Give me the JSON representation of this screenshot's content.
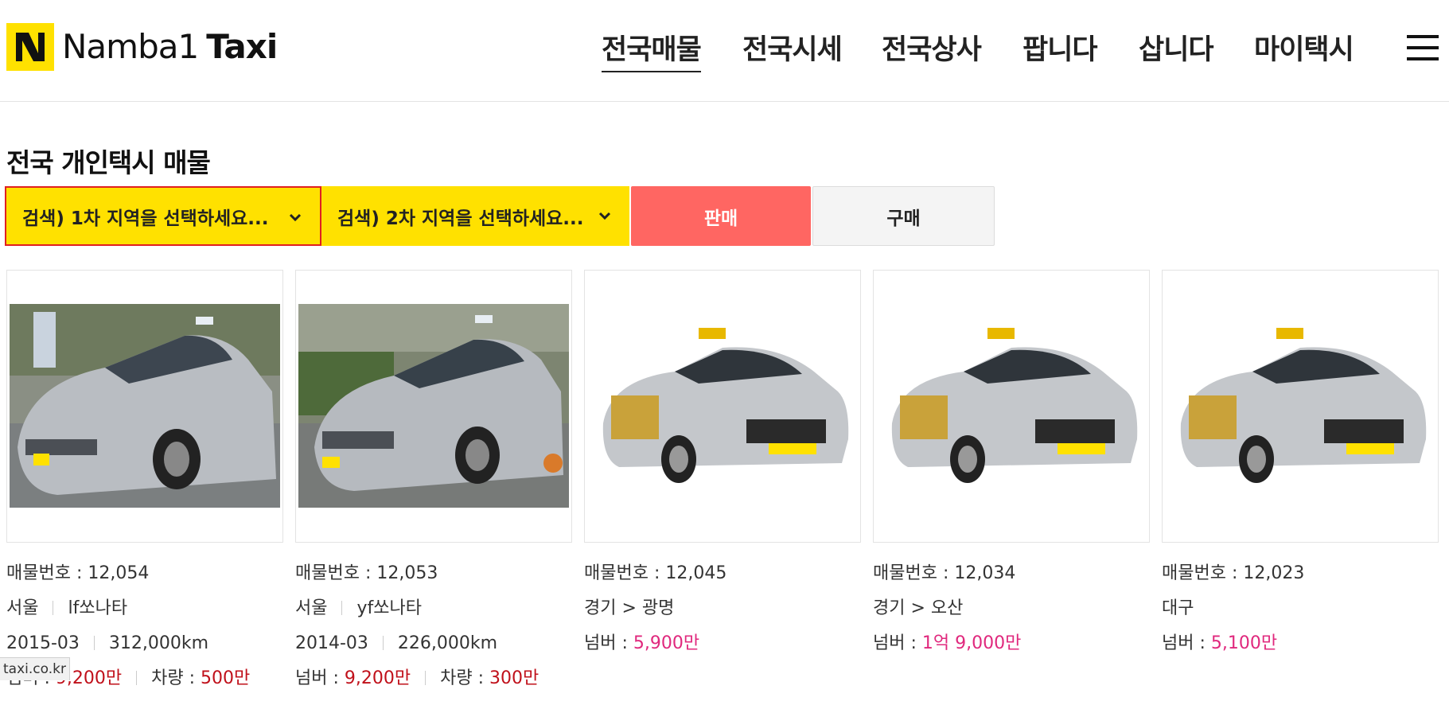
{
  "header": {
    "logo_text_regular": "Namba1",
    "logo_text_bold": "Taxi",
    "nav": [
      {
        "label": "전국매물",
        "active": true
      },
      {
        "label": "전국시세",
        "active": false
      },
      {
        "label": "전국상사",
        "active": false
      },
      {
        "label": "팝니다",
        "active": false
      },
      {
        "label": "삽니다",
        "active": false
      },
      {
        "label": "마이택시",
        "active": false
      }
    ]
  },
  "page": {
    "title": "전국 개인택시 매물"
  },
  "filters": {
    "region1": "검색) 1차 지역을 선택하세요...",
    "region2": "검색) 2차 지역을 선택하세요...",
    "sell_label": "판매",
    "buy_label": "구매"
  },
  "listings": [
    {
      "number": "매물번호 : 12,054",
      "region": "서울",
      "model": "lf쏘나타",
      "year": "2015-03",
      "mileage": "312,000km",
      "plate_label": "넘버 : ",
      "plate_price": "9,200만",
      "car_label": "차량 : ",
      "car_price": "500만"
    },
    {
      "number": "매물번호 : 12,053",
      "region": "서울",
      "model": "yf쏘나타",
      "year": "2014-03",
      "mileage": "226,000km",
      "plate_label": "넘버 : ",
      "plate_price": "9,200만",
      "car_label": "차량 : ",
      "car_price": "300만"
    },
    {
      "number": "매물번호 : 12,045",
      "region": "경기 > 광명",
      "plate_label": "넘버 : ",
      "plate_price": "5,900만"
    },
    {
      "number": "매물번호 : 12,034",
      "region": "경기 > 오산",
      "plate_label": "넘버 : ",
      "plate_price": "1억 9,000만"
    },
    {
      "number": "매물번호 : 12,023",
      "region": "대구",
      "plate_label": "넘버 : ",
      "plate_price": "5,100만"
    }
  ],
  "status_bar": {
    "url": "taxi.co.kr"
  },
  "colors": {
    "brand_yellow": "#ffe100",
    "sell_red": "#ff6662",
    "price_pink": "#e0287d"
  }
}
